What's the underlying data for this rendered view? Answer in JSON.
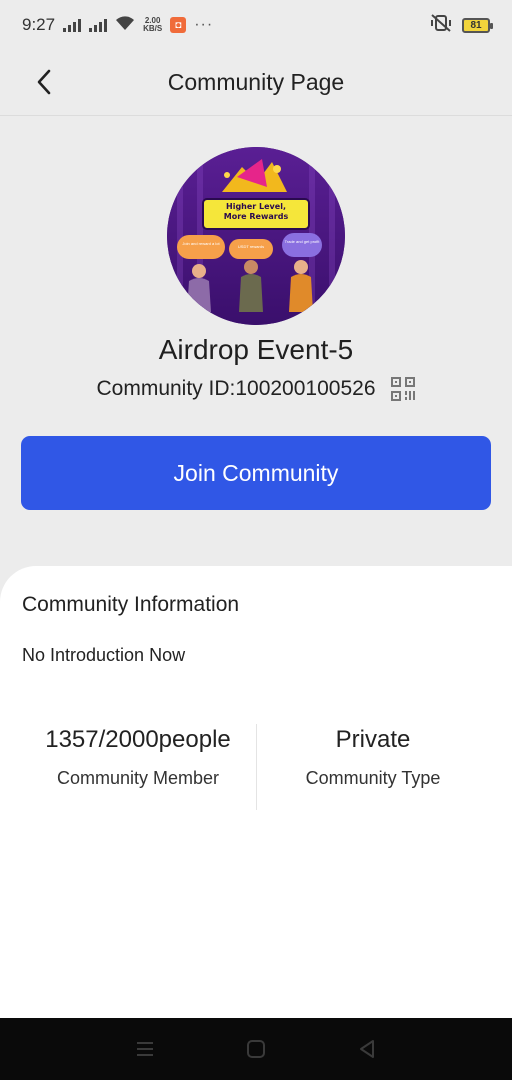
{
  "status_bar": {
    "time": "9:27",
    "speed_top": "2.00",
    "speed_bottom": "KB/S",
    "more": "···",
    "battery": "81"
  },
  "header": {
    "title": "Community Page",
    "back_icon": "chevron-left-icon"
  },
  "avatar": {
    "banner_line1": "Higher Level,",
    "banner_line2": "More Rewards",
    "bubble1": "Trade and get profit",
    "bubble2": "USDT rewards",
    "bubble3": "Join and reward a lot"
  },
  "community": {
    "name": "Airdrop Event-5",
    "id_label": "Community ID:100200100526",
    "qr_icon": "qr-code-icon"
  },
  "join_button": {
    "label": "Join Community",
    "color": "#3057e6"
  },
  "info": {
    "heading": "Community Information",
    "intro": "No Introduction Now",
    "stats": [
      {
        "value": "1357/2000people",
        "label": "Community Member"
      },
      {
        "value": "Private",
        "label": "Community Type"
      }
    ]
  },
  "nav_bar": {
    "menu_icon": "menu-icon",
    "home_icon": "home-square-icon",
    "back_icon": "back-triangle-icon"
  }
}
